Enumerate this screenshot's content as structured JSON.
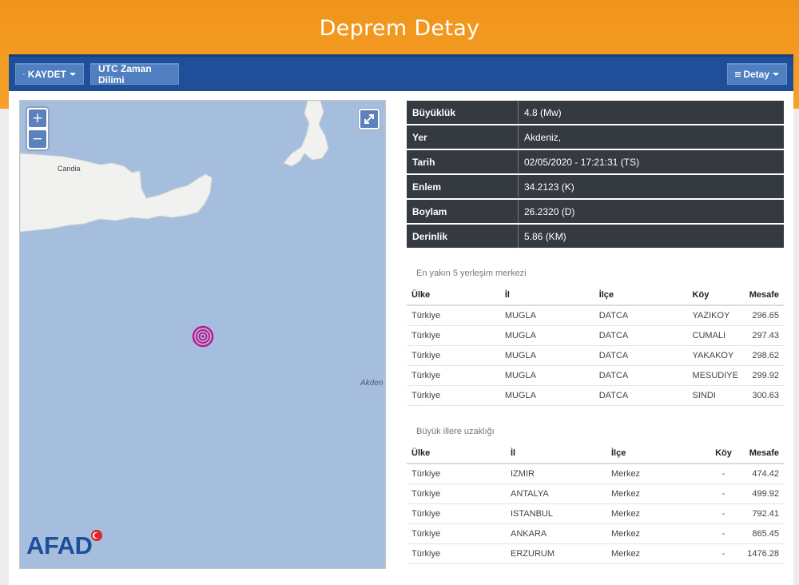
{
  "page": {
    "title": "Deprem Detay"
  },
  "toolbar": {
    "save_label": "KAYDET",
    "utc_label": "UTC Zaman Dilimi",
    "detail_label": "Detay"
  },
  "map": {
    "zoom_in": "+",
    "zoom_out": "−",
    "label_candia": "Candia",
    "label_akdeniz": "Akden",
    "logo_text": "AFAD"
  },
  "details": [
    {
      "key": "Büyüklük",
      "value": "4.8 (Mw)"
    },
    {
      "key": "Yer",
      "value": "Akdeniz,"
    },
    {
      "key": "Tarih",
      "value": "02/05/2020 - 17:21:31 (TS)"
    },
    {
      "key": "Enlem",
      "value": "34.2123 (K)"
    },
    {
      "key": "Boylam",
      "value": "26.2320 (D)"
    },
    {
      "key": "Derinlik",
      "value": "5.86 (KM)"
    }
  ],
  "nearest": {
    "caption": "En yakın 5 yerleşim merkezi",
    "headers": [
      "Ülke",
      "İl",
      "İlçe",
      "Köy",
      "Mesafe"
    ],
    "rows": [
      [
        "Türkiye",
        "MUGLA",
        "DATCA",
        "YAZIKOY",
        "296.65"
      ],
      [
        "Türkiye",
        "MUGLA",
        "DATCA",
        "CUMALI",
        "297.43"
      ],
      [
        "Türkiye",
        "MUGLA",
        "DATCA",
        "YAKAKOY",
        "298.62"
      ],
      [
        "Türkiye",
        "MUGLA",
        "DATCA",
        "MESUDIYE",
        "299.92"
      ],
      [
        "Türkiye",
        "MUGLA",
        "DATCA",
        "SINDI",
        "300.63"
      ]
    ]
  },
  "cities": {
    "caption": "Büyük illere uzaklığı",
    "headers": [
      "Ülke",
      "İl",
      "İlçe",
      "Köy",
      "Mesafe"
    ],
    "rows": [
      [
        "Türkiye",
        "IZMIR",
        "Merkez",
        "-",
        "474.42"
      ],
      [
        "Türkiye",
        "ANTALYA",
        "Merkez",
        "-",
        "499.92"
      ],
      [
        "Türkiye",
        "ISTANBUL",
        "Merkez",
        "-",
        "792.41"
      ],
      [
        "Türkiye",
        "ANKARA",
        "Merkez",
        "-",
        "865.45"
      ],
      [
        "Türkiye",
        "ERZURUM",
        "Merkez",
        "-",
        "1476.28"
      ]
    ]
  },
  "colors": {
    "banner": "#f7a12a",
    "navbar": "#1f4f99",
    "button": "#4f7fc0",
    "sea": "#a6bedd",
    "epicenter": "#c0188f"
  }
}
